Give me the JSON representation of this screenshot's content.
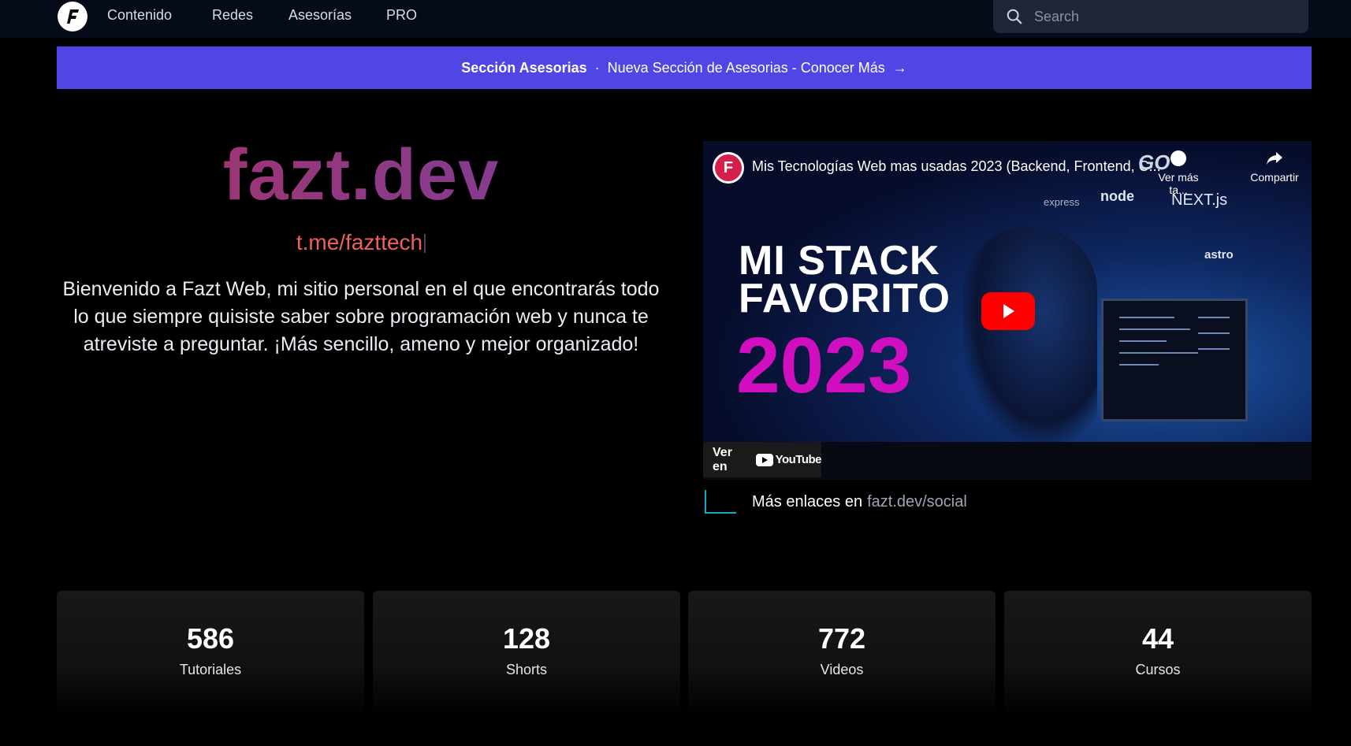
{
  "nav": {
    "logo_letter": "F",
    "links": [
      "Contenido",
      "Redes",
      "Asesorías",
      "PRO"
    ],
    "search_placeholder": "Search"
  },
  "banner": {
    "bold": "Sección Asesorias",
    "separator": "·",
    "text": "Nueva Sección de Asesorias - Conocer Más",
    "arrow": "→"
  },
  "hero": {
    "title": "fazt.dev",
    "link": "t.me/fazttech",
    "description": "Bienvenido a Fazt Web, mi sitio personal en el que encontrarás todo lo que siempre quisiste saber sobre programación web y nunca te atreviste a preguntar. ¡Más sencillo, ameno y mejor organizado!"
  },
  "video": {
    "title": "Mis Tecnologías Web mas usadas 2023 (Backend, Frontend, C...",
    "watch_later": "Ver más ta...",
    "share": "Compartir",
    "headline_1": "MI STACK",
    "headline_2": "FAVORITO",
    "year": "2023",
    "tech_labels": [
      "GO",
      "express",
      "node",
      "NEXT.js",
      "astro"
    ],
    "watch_on": "Ver en",
    "youtube": "YouTube"
  },
  "more_links": {
    "text": "Más enlaces en",
    "link": "fazt.dev/social"
  },
  "stats": [
    {
      "value": "586",
      "label": "Tutoriales"
    },
    {
      "value": "128",
      "label": "Shorts"
    },
    {
      "value": "772",
      "label": "Videos"
    },
    {
      "value": "44",
      "label": "Cursos"
    }
  ]
}
